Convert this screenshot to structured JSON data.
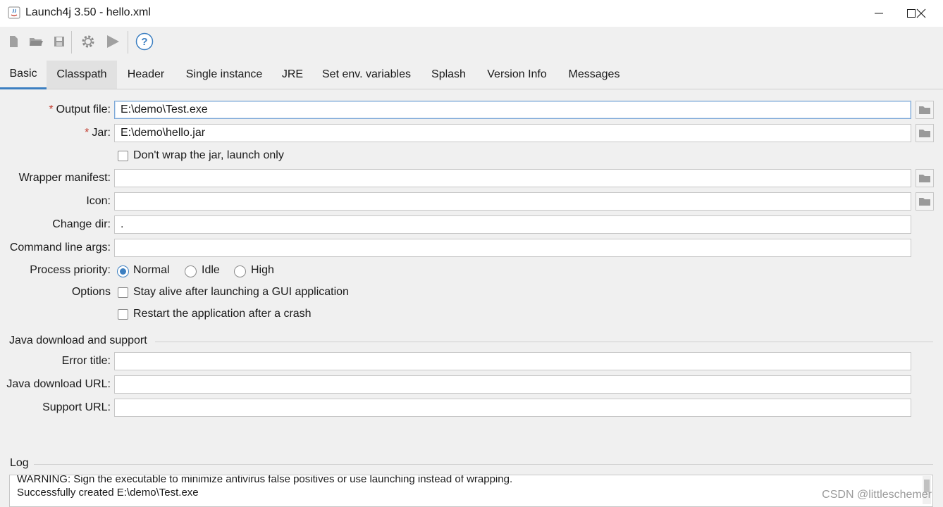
{
  "window": {
    "title": "Launch4j 3.50 - hello.xml"
  },
  "toolbar": {
    "icons": [
      "new-file-icon",
      "open-folder-icon",
      "save-icon",
      "build-gear-icon",
      "run-icon",
      "help-icon"
    ]
  },
  "tabs": [
    {
      "label": "Basic",
      "active": true
    },
    {
      "label": "Classpath",
      "hover": true
    },
    {
      "label": "Header"
    },
    {
      "label": "Single instance"
    },
    {
      "label": "JRE"
    },
    {
      "label": "Set env. variables"
    },
    {
      "label": "Splash"
    },
    {
      "label": "Version Info"
    },
    {
      "label": "Messages"
    }
  ],
  "basic": {
    "required_marker": "*",
    "output_file": {
      "label": "Output file:",
      "value": "E:\\demo\\Test.exe"
    },
    "jar": {
      "label": "Jar:",
      "value": "E:\\demo\\hello.jar"
    },
    "dont_wrap": {
      "label": "Don't wrap the jar, launch only",
      "checked": false
    },
    "wrapper_manifest": {
      "label": "Wrapper manifest:",
      "value": ""
    },
    "icon": {
      "label": "Icon:",
      "value": ""
    },
    "change_dir": {
      "label": "Change dir:",
      "value": "."
    },
    "cmd_args": {
      "label": "Command line args:",
      "value": ""
    },
    "process_priority": {
      "label": "Process priority:",
      "options": [
        "Normal",
        "Idle",
        "High"
      ],
      "selected": "Normal"
    },
    "options": {
      "label": "Options",
      "stay_alive": {
        "label": "Stay alive after launching a GUI application",
        "checked": false
      },
      "restart": {
        "label": "Restart the application after a crash",
        "checked": false
      }
    }
  },
  "java_download": {
    "section_title": "Java download and support",
    "error_title": {
      "label": "Error title:",
      "value": ""
    },
    "download_url": {
      "label": "Java download URL:",
      "value": ""
    },
    "support_url": {
      "label": "Support URL:",
      "value": ""
    }
  },
  "log": {
    "title": "Log",
    "lines": [
      "WARNING: Sign the executable to minimize antivirus false positives or use launching instead of wrapping.",
      "Successfully created E:\\demo\\Test.exe"
    ]
  },
  "watermark": "CSDN @littleschemer",
  "colors": {
    "accent": "#3c7fc1",
    "required": "#c0392b"
  }
}
